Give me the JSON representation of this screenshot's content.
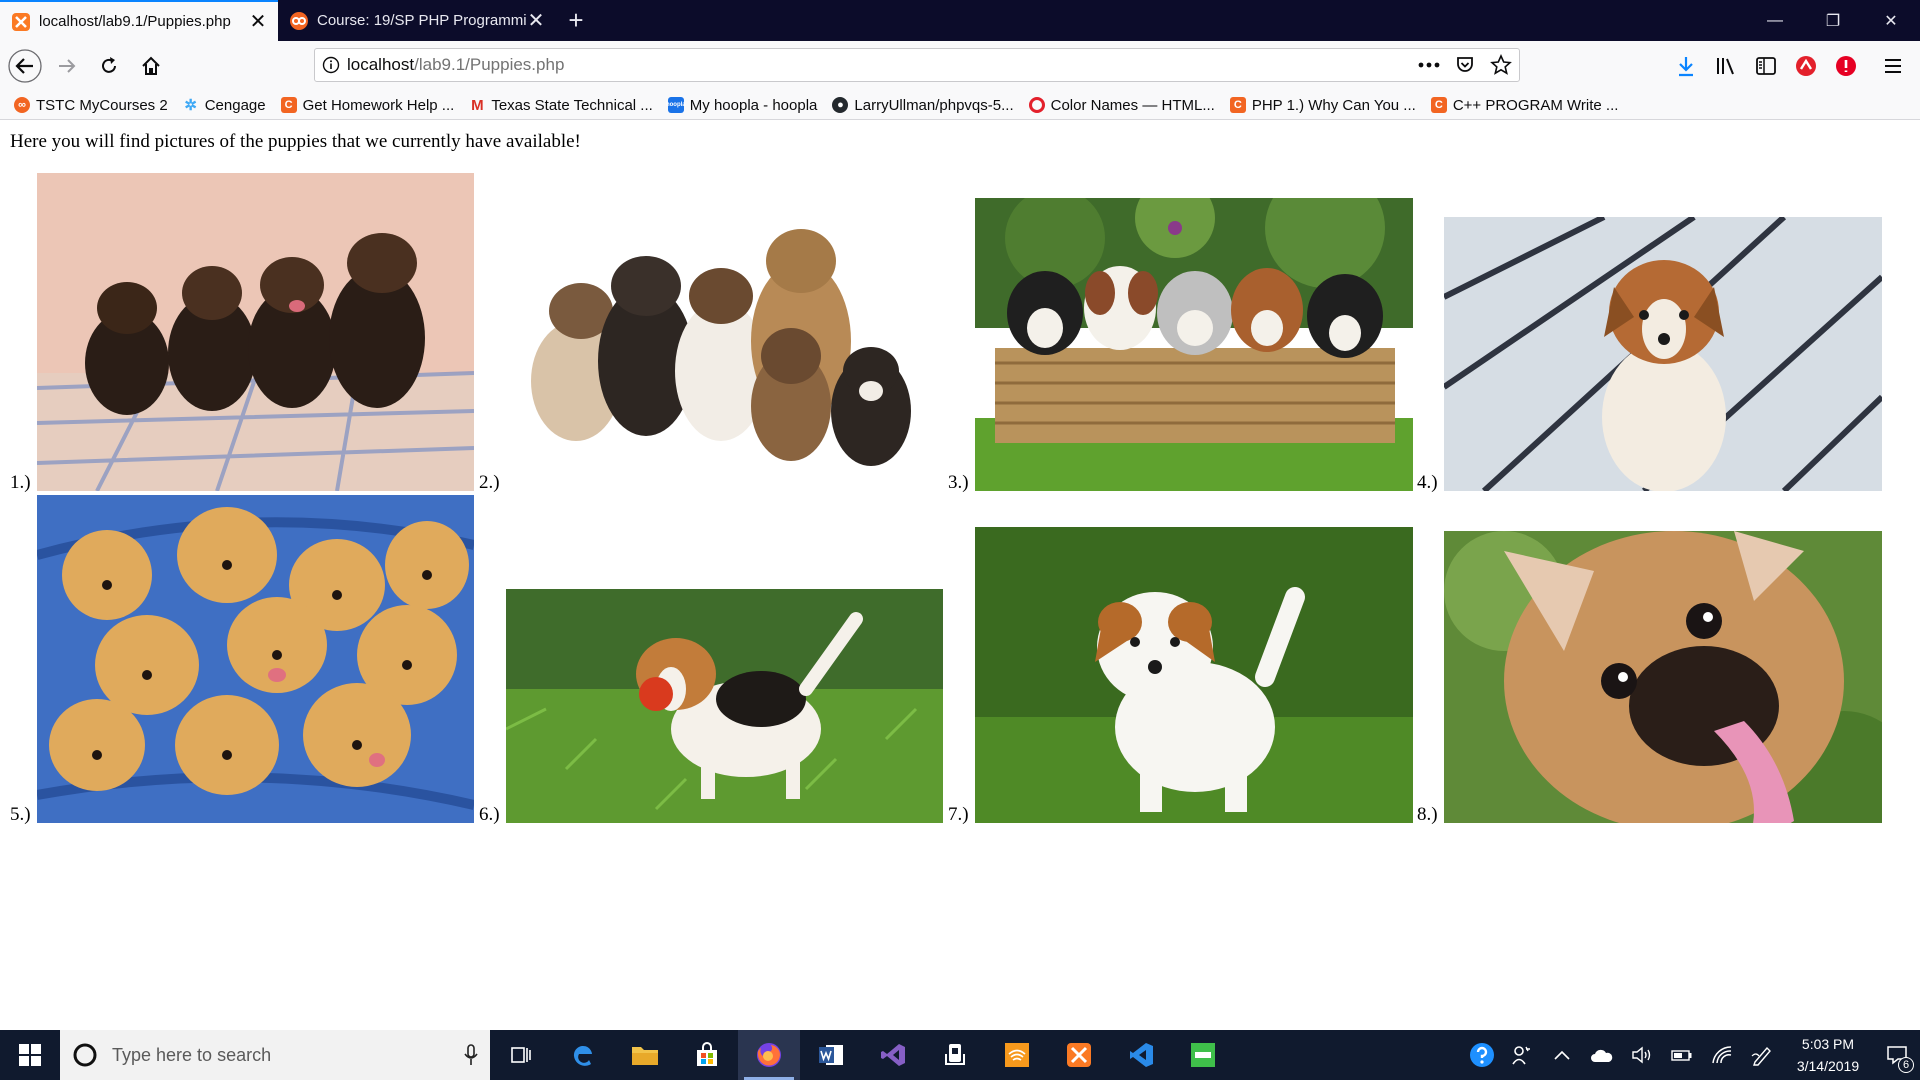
{
  "browser": {
    "tabs": [
      {
        "title": "localhost/lab9.1/Puppies.php",
        "active": true,
        "favicon": "xampp-icon"
      },
      {
        "title": "Course: 19/SP PHP Programmin",
        "active": false,
        "favicon": "moodle-icon"
      }
    ],
    "new_tab": "+",
    "url": {
      "host": "localhost",
      "path": "/lab9.1/Puppies.php"
    },
    "bookmarks": [
      {
        "label": "TSTC MyCourses 2",
        "icon": "moodle-icon",
        "color": "#f26522"
      },
      {
        "label": "Cengage",
        "icon": "cengage-icon",
        "color": "#3fa9f5"
      },
      {
        "label": "Get Homework Help ...",
        "icon": "chegg-icon",
        "color": "#f26522"
      },
      {
        "label": "Texas State Technical ...",
        "icon": "gmail-icon",
        "color": "#d93025"
      },
      {
        "label": "My hoopla - hoopla",
        "icon": "hoopla-icon",
        "color": "#1a73e8"
      },
      {
        "label": "LarryUllman/phpvqs-5...",
        "icon": "github-icon",
        "color": "#24292e"
      },
      {
        "label": "Color Names — HTML...",
        "icon": "opera-icon",
        "color": "#e3202b"
      },
      {
        "label": "PHP 1.) Why Can You ...",
        "icon": "chegg-icon",
        "color": "#f26522"
      },
      {
        "label": "C++ PROGRAM Write ...",
        "icon": "chegg-icon",
        "color": "#f26522"
      }
    ]
  },
  "page": {
    "intro": "Here you will find pictures of the puppies that we currently have available!",
    "puppies": [
      {
        "label": "1.)",
        "alt": "yorkie puppies on blanket"
      },
      {
        "label": "2.)",
        "alt": "mixed breed puppies"
      },
      {
        "label": "3.)",
        "alt": "puppies in basket"
      },
      {
        "label": "4.)",
        "alt": "corgi puppy"
      },
      {
        "label": "5.)",
        "alt": "golden retriever puppies"
      },
      {
        "label": "6.)",
        "alt": "beagle puppy with ball"
      },
      {
        "label": "7.)",
        "alt": "jack russell puppy"
      },
      {
        "label": "8.)",
        "alt": "french bulldog puppy"
      }
    ]
  },
  "taskbar": {
    "search_placeholder": "Type here to search",
    "apps": [
      "task-view-icon",
      "edge-icon",
      "file-explorer-icon",
      "store-icon",
      "firefox-icon",
      "word-icon",
      "visual-studio-icon",
      "mixer-icon",
      "audible-icon",
      "xampp-icon",
      "vscode-icon",
      "hoopla-icon"
    ],
    "active_app": "firefox-icon",
    "time": "5:03 PM",
    "date": "3/14/2019",
    "notifications": "6"
  }
}
